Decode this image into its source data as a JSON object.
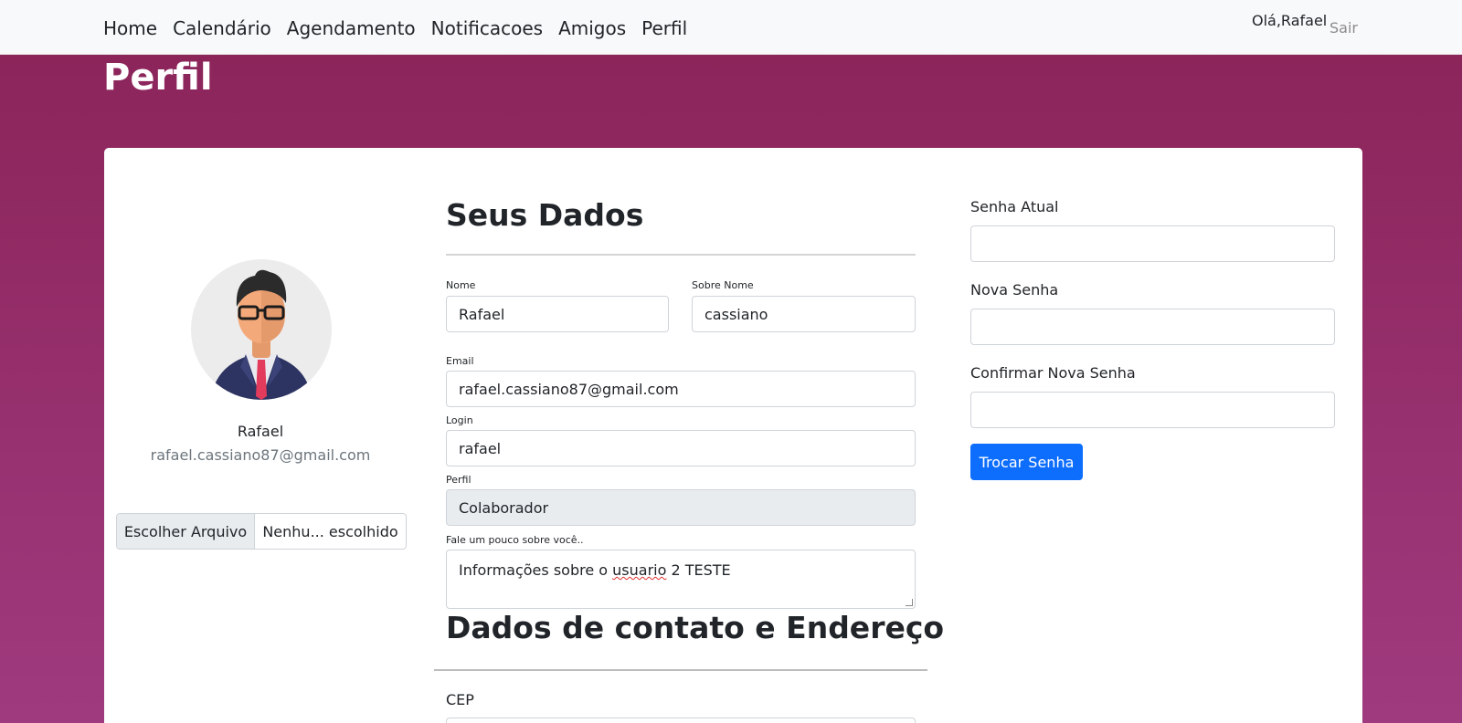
{
  "nav": {
    "items": [
      {
        "label": "Home"
      },
      {
        "label": "Calendário"
      },
      {
        "label": "Agendamento"
      },
      {
        "label": "Notificacoes"
      },
      {
        "label": "Amigos"
      },
      {
        "label": "Perfil"
      }
    ],
    "greeting": "Olá,Rafael",
    "logout": "Sair"
  },
  "page_title": "Perfil",
  "profile": {
    "name": "Rafael",
    "email": "rafael.cassiano87@gmail.com",
    "file_button": "Escolher Arquivo",
    "file_status": "Nenhu... escolhido"
  },
  "seus_dados": {
    "heading": "Seus Dados",
    "nome_label": "Nome",
    "nome_value": "Rafael",
    "sobrenome_label": "Sobre Nome",
    "sobrenome_value": "cassiano",
    "email_label": "Email",
    "email_value": "rafael.cassiano87@gmail.com",
    "login_label": "Login",
    "login_value": "rafael",
    "perfil_label": "Perfil",
    "perfil_value": "Colaborador",
    "sobre_label": "Fale um pouco sobre você..",
    "sobre_value_pre": "Informações sobre o ",
    "sobre_value_misspelled": "usuario",
    "sobre_value_post": " 2 TESTE"
  },
  "contato": {
    "heading": "Dados de contato e Endereço",
    "cep_label": "CEP"
  },
  "senha": {
    "atual_label": "Senha Atual",
    "nova_label": "Nova Senha",
    "confirmar_label": "Confirmar Nova Senha",
    "button": "Trocar Senha"
  },
  "colors": {
    "background_top": "#8a2357",
    "background_bottom": "#a03a7f",
    "primary": "#0d6efd",
    "navbar": "#f8f9fa"
  }
}
